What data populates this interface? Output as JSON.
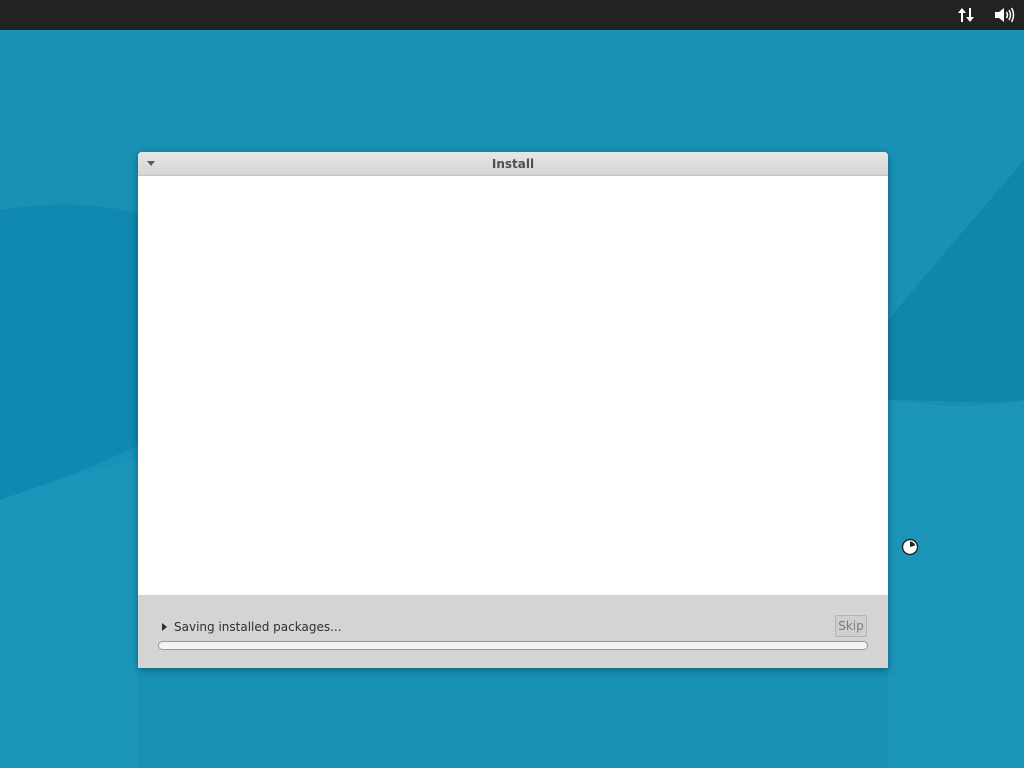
{
  "window": {
    "title": "Install"
  },
  "bottom_panel": {
    "status_text": "Saving installed packages...",
    "skip_label": "Skip",
    "progress_fraction": 0
  },
  "tray": {
    "network_icon": "network-transfer-icon",
    "volume_icon": "volume-icon"
  },
  "colors": {
    "desktop": "#1a93b6",
    "panel": "#222222",
    "dialog_bottom": "#d4d4d4"
  }
}
